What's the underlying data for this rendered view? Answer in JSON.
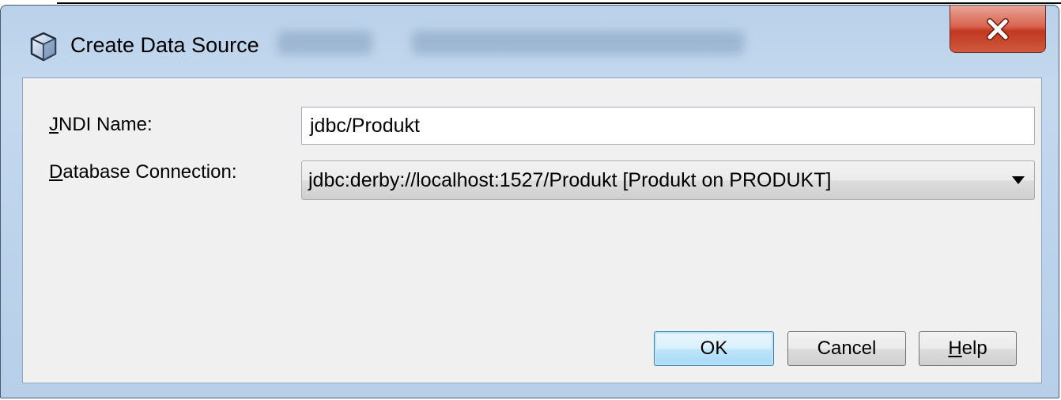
{
  "window": {
    "title": "Create Data Source",
    "icon": "cube-icon",
    "close_icon": "close-x-icon"
  },
  "form": {
    "jndi_label_mnemonic": "J",
    "jndi_label_rest": "NDI Name:",
    "jndi_value": "jdbc/Produkt",
    "db_label_mnemonic": "D",
    "db_label_rest": "atabase Connection:",
    "db_selected": "jdbc:derby://localhost:1527/Produkt [Produkt on PRODUKT]"
  },
  "buttons": {
    "ok": "OK",
    "cancel": "Cancel",
    "help_mnemonic": "H",
    "help_rest": "elp"
  },
  "colors": {
    "frame": "#b9d1ea",
    "client": "#f0f0f0",
    "close": "#c1381f",
    "default_button": "#bee6fd"
  }
}
